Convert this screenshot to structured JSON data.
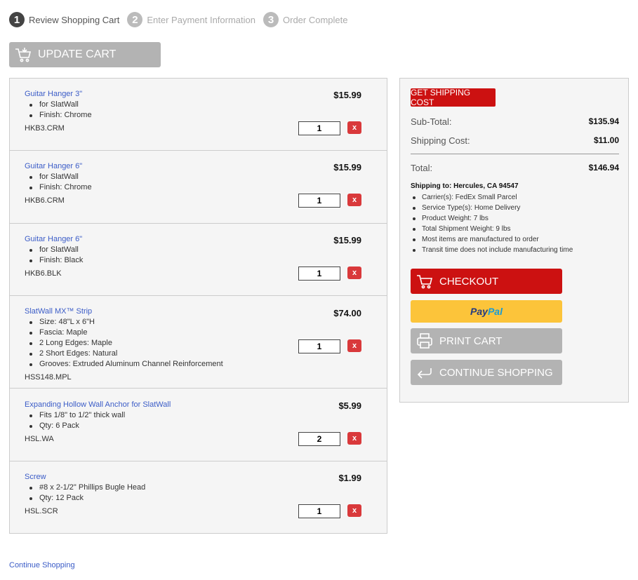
{
  "steps": [
    {
      "num": "1",
      "label": "Review Shopping Cart"
    },
    {
      "num": "2",
      "label": "Enter Payment Information"
    },
    {
      "num": "3",
      "label": "Order Complete"
    }
  ],
  "update_cart_label": "UPDATE CART",
  "items": [
    {
      "name": "Guitar Hanger 3\"",
      "bullets": [
        "for SlatWall",
        "Finish: Chrome"
      ],
      "sku": "HKB3.CRM",
      "price": "$15.99",
      "qty": "1"
    },
    {
      "name": "Guitar Hanger 6\"",
      "bullets": [
        "for SlatWall",
        "Finish: Chrome"
      ],
      "sku": "HKB6.CRM",
      "price": "$15.99",
      "qty": "1"
    },
    {
      "name": "Guitar Hanger 6\"",
      "bullets": [
        "for SlatWall",
        "Finish: Black"
      ],
      "sku": "HKB6.BLK",
      "price": "$15.99",
      "qty": "1"
    },
    {
      "name": "SlatWall MX™ Strip",
      "bullets": [
        "Size: 48\"L x 6\"H",
        "Fascia: Maple",
        "2 Long Edges: Maple",
        "2 Short Edges: Natural",
        "Grooves: Extruded Aluminum Channel Reinforcement"
      ],
      "sku": "HSS148.MPL",
      "price": "$74.00",
      "qty": "1"
    },
    {
      "name": "Expanding Hollow Wall Anchor for SlatWall",
      "bullets": [
        "Fits 1/8\" to 1/2\" thick wall",
        "Qty: 6 Pack"
      ],
      "sku": "HSL.WA",
      "price": "$5.99",
      "qty": "2"
    },
    {
      "name": "Screw",
      "bullets": [
        "#8 x 2-1/2\" Phillips Bugle Head",
        "Qty: 12 Pack"
      ],
      "sku": "HSL.SCR",
      "price": "$1.99",
      "qty": "1"
    }
  ],
  "remove_label": "x",
  "summary": {
    "get_shipping_label": "GET SHIPPING COST",
    "subtotal_label": "Sub-Total:",
    "subtotal_value": "$135.94",
    "shipping_label": "Shipping Cost:",
    "shipping_value": "$11.00",
    "total_label": "Total:",
    "total_value": "$146.94",
    "ship_to": "Shipping to: Hercules, CA 94547",
    "ship_details": [
      "Carrier(s): FedEx Small Parcel",
      "Service Type(s): Home Delivery",
      "Product Weight: 7 lbs",
      "Total Shipment Weight: 9 lbs",
      "Most items are manufactured to order",
      "Transit time does not include manufacturing time"
    ],
    "checkout_label": "CHECKOUT",
    "paypal_pay": "Pay",
    "paypal_pal": "Pal",
    "print_label": "PRINT CART",
    "continue_label": "CONTINUE SHOPPING"
  },
  "footer_link": "Continue Shopping",
  "colors": {
    "accent_red": "#cc1111",
    "gray_button": "#b3b3b3",
    "paypal_yellow": "#fcc43a",
    "link_blue": "#3b5cc7"
  },
  "icons": [
    "cart-icon",
    "printer-icon",
    "return-arrow-icon",
    "remove-icon"
  ]
}
